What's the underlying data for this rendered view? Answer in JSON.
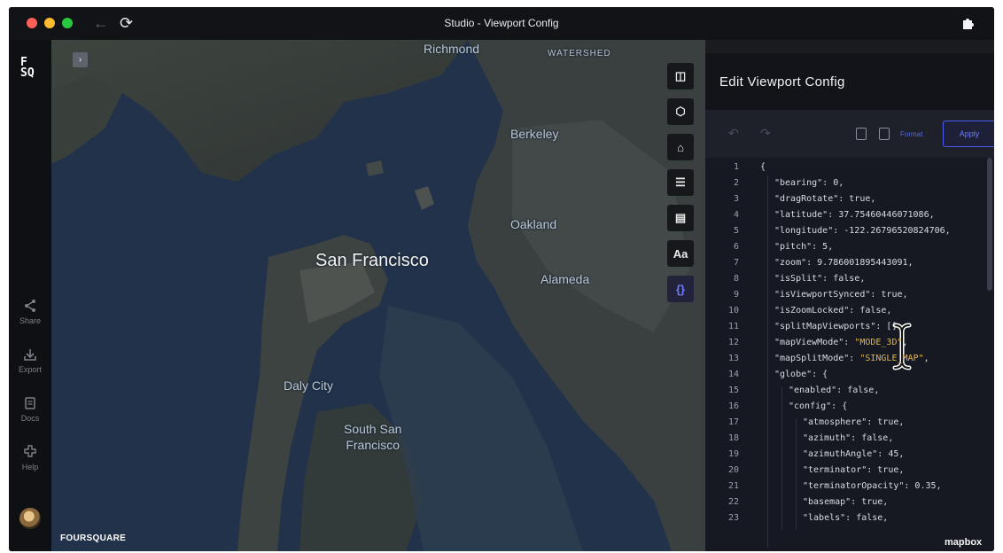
{
  "window": {
    "title": "Studio - Viewport Config"
  },
  "nav": {
    "back_glyph": "←",
    "reload_glyph": "⟳"
  },
  "rail": {
    "logo_line1": "F",
    "logo_line2": "SQ",
    "items": [
      {
        "label": "Share",
        "icon": "share-icon"
      },
      {
        "label": "Export",
        "icon": "export-icon"
      },
      {
        "label": "Docs",
        "icon": "docs-icon"
      },
      {
        "label": "Help",
        "icon": "help-icon"
      }
    ]
  },
  "map": {
    "places": {
      "richmond": "Richmond",
      "watershed": "WATERSHED",
      "berkeley": "Berkeley",
      "oakland": "Oakland",
      "san_francisco": "San Francisco",
      "alameda": "Alameda",
      "daly_city": "Daly City",
      "south_sf_line1": "South San",
      "south_sf_line2": "Francisco"
    },
    "brand": "FOURSQUARE",
    "mapbox": "mapbox",
    "collapse_glyph": "›",
    "toolbar": [
      {
        "name": "split-map-button",
        "icon": "split-map-icon",
        "glyph": "◫"
      },
      {
        "name": "3d-view-button",
        "icon": "cube-icon",
        "glyph": "⬡"
      },
      {
        "name": "draw-polygon-button",
        "icon": "polygon-icon",
        "glyph": "⌂"
      },
      {
        "name": "layer-list-button",
        "icon": "list-icon",
        "glyph": "☰"
      },
      {
        "name": "legend-button",
        "icon": "legend-icon",
        "glyph": "▤"
      },
      {
        "name": "labels-button",
        "icon": "text-icon",
        "glyph": "Aa"
      },
      {
        "name": "viewport-config-button",
        "icon": "braces-icon",
        "glyph": "{}"
      }
    ]
  },
  "panel": {
    "title": "Edit Viewport Config",
    "undo_glyph": "↶",
    "redo_glyph": "↷",
    "format_label": "Format",
    "apply_label": "Apply",
    "lines": [
      {
        "n": "1",
        "indent": 0,
        "parts": [
          {
            "t": "{"
          }
        ]
      },
      {
        "n": "2",
        "indent": 1,
        "parts": [
          {
            "t": "\"bearing\": 0,"
          }
        ]
      },
      {
        "n": "3",
        "indent": 1,
        "parts": [
          {
            "t": "\"dragRotate\": true,"
          }
        ]
      },
      {
        "n": "4",
        "indent": 1,
        "parts": [
          {
            "t": "\"latitude\": 37.75460446071086,"
          }
        ]
      },
      {
        "n": "5",
        "indent": 1,
        "parts": [
          {
            "t": "\"longitude\": -122.26796520824706,"
          }
        ]
      },
      {
        "n": "6",
        "indent": 1,
        "parts": [
          {
            "t": "\"pitch\": 5,"
          }
        ]
      },
      {
        "n": "7",
        "indent": 1,
        "parts": [
          {
            "t": "\"zoom\": 9.786001895443091,"
          }
        ]
      },
      {
        "n": "8",
        "indent": 1,
        "parts": [
          {
            "t": "\"isSplit\": false,"
          }
        ]
      },
      {
        "n": "9",
        "indent": 1,
        "parts": [
          {
            "t": "\"isViewportSynced\": true,"
          }
        ]
      },
      {
        "n": "10",
        "indent": 1,
        "parts": [
          {
            "t": "\"isZoomLocked\": false,"
          }
        ]
      },
      {
        "n": "11",
        "indent": 1,
        "parts": [
          {
            "t": "\"splitMapViewports\": [],"
          }
        ]
      },
      {
        "n": "12",
        "indent": 1,
        "parts": [
          {
            "t": "\"mapViewMode\": "
          },
          {
            "t": "\"MODE_3D\"",
            "s": true
          },
          {
            "t": ","
          }
        ]
      },
      {
        "n": "13",
        "indent": 1,
        "parts": [
          {
            "t": "\"mapSplitMode\": "
          },
          {
            "t": "\"SINGLE_MAP\"",
            "s": true
          },
          {
            "t": ","
          }
        ]
      },
      {
        "n": "14",
        "indent": 1,
        "parts": [
          {
            "t": "\"globe\": {"
          }
        ]
      },
      {
        "n": "15",
        "indent": 2,
        "parts": [
          {
            "t": "\"enabled\": false,"
          }
        ]
      },
      {
        "n": "16",
        "indent": 2,
        "parts": [
          {
            "t": "\"config\": {"
          }
        ]
      },
      {
        "n": "17",
        "indent": 3,
        "parts": [
          {
            "t": "\"atmosphere\": true,"
          }
        ]
      },
      {
        "n": "18",
        "indent": 3,
        "parts": [
          {
            "t": "\"azimuth\": false,"
          }
        ]
      },
      {
        "n": "19",
        "indent": 3,
        "parts": [
          {
            "t": "\"azimuthAngle\": 45,"
          }
        ]
      },
      {
        "n": "20",
        "indent": 3,
        "parts": [
          {
            "t": "\"terminator\": true,"
          }
        ]
      },
      {
        "n": "21",
        "indent": 3,
        "parts": [
          {
            "t": "\"terminatorOpacity\": 0.35,"
          }
        ]
      },
      {
        "n": "22",
        "indent": 3,
        "parts": [
          {
            "t": "\"basemap\": true,"
          }
        ]
      },
      {
        "n": "23",
        "indent": 3,
        "parts": [
          {
            "t": "\"labels\": false,"
          }
        ]
      }
    ]
  },
  "colors": {
    "accent": "#5564e8",
    "string": "#e2b64a",
    "panel_bg": "#1e2129",
    "editor_bg": "#161922"
  }
}
